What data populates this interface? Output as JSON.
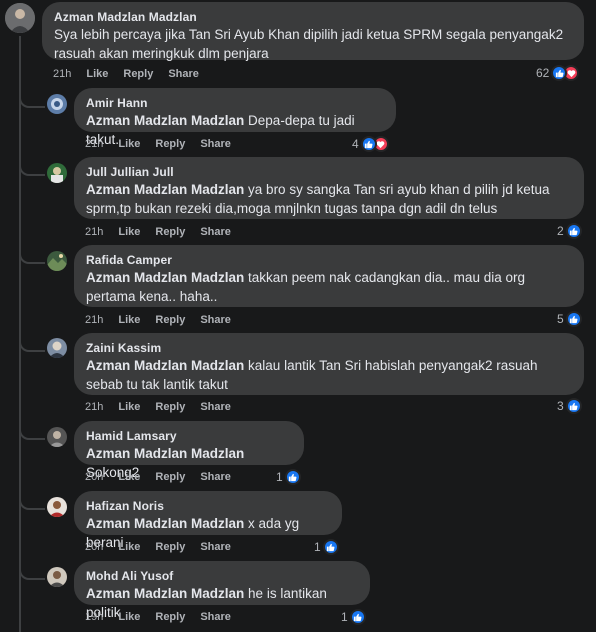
{
  "comments": [
    {
      "author": "Azman Madzlan Madzlan",
      "mention": "",
      "text": "Sya lebih percaya jika Tan Sri Ayub Khan dipilih jadi ketua SPRM segala penyangak2 rasuah akan meringkuk dlm penjara",
      "time": "21h",
      "like": "Like",
      "reply": "Reply",
      "share": "Share",
      "reaction_count": "62",
      "reactions": [
        "like-icon",
        "love-icon"
      ]
    },
    {
      "author": "Amir Hann",
      "mention": "Azman Madzlan Madzlan",
      "text": "Depa-depa tu jadi takut.",
      "time": "21h",
      "like": "Like",
      "reply": "Reply",
      "share": "Share",
      "reaction_count": "4",
      "reactions": [
        "like-icon",
        "love-icon"
      ]
    },
    {
      "author": "Jull Jullian Jull",
      "mention": "Azman Madzlan Madzlan",
      "text": "ya bro sy sangka Tan sri ayub khan d pilih jd ketua sprm,tp bukan rezeki dia,moga mnjlnkn tugas tanpa dgn adil dn telus",
      "time": "21h",
      "like": "Like",
      "reply": "Reply",
      "share": "Share",
      "reaction_count": "2",
      "reactions": [
        "like-icon"
      ]
    },
    {
      "author": "Rafida Camper",
      "mention": "Azman Madzlan Madzlan",
      "text": "takkan peem nak cadangkan dia.. mau dia org pertama kena.. haha..",
      "time": "21h",
      "like": "Like",
      "reply": "Reply",
      "share": "Share",
      "reaction_count": "5",
      "reactions": [
        "like-icon"
      ]
    },
    {
      "author": "Zaini Kassim",
      "mention": "Azman Madzlan Madzlan",
      "text": "kalau lantik Tan Sri habislah penyangak2 rasuah sebab tu tak lantik takut",
      "time": "21h",
      "like": "Like",
      "reply": "Reply",
      "share": "Share",
      "reaction_count": "3",
      "reactions": [
        "like-icon"
      ]
    },
    {
      "author": "Hamid Lamsary",
      "mention": "Azman Madzlan Madzlan",
      "text": "Sokong2",
      "time": "20h",
      "like": "Like",
      "reply": "Reply",
      "share": "Share",
      "reaction_count": "1",
      "reactions": [
        "like-icon"
      ]
    },
    {
      "author": "Hafizan Noris",
      "mention": "Azman Madzlan Madzlan",
      "text": "x ada yg berani",
      "time": "20h",
      "like": "Like",
      "reply": "Reply",
      "share": "Share",
      "reaction_count": "1",
      "reactions": [
        "like-icon"
      ]
    },
    {
      "author": "Mohd Ali Yusof",
      "mention": "Azman Madzlan Madzlan",
      "text": "he is lantikan politik",
      "time": "19h",
      "like": "Like",
      "reply": "Reply",
      "share": "Share",
      "reaction_count": "1",
      "reactions": [
        "like-icon"
      ]
    }
  ],
  "colors": {
    "background": "#18191a",
    "bubble": "#3a3b3c",
    "text": "#e4e6eb",
    "secondary": "#b0b3b8",
    "like": "#1877f2",
    "love": "#f33e58"
  }
}
